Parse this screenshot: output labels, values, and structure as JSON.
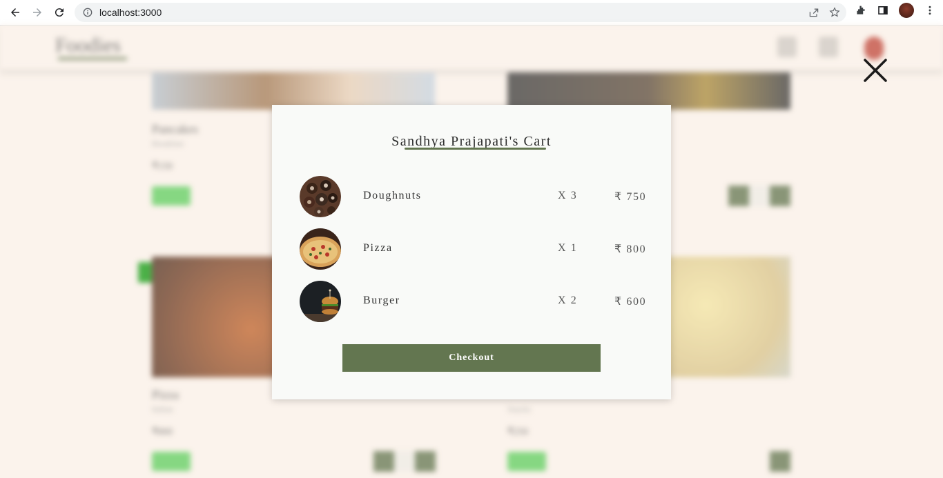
{
  "browser": {
    "url": "localhost:3000"
  },
  "app": {
    "logo": "Foodies",
    "cards": [
      {
        "title": "Pancakes",
        "subtitle": "Breakfast",
        "price": "₹150"
      },
      {
        "title": "Pizza",
        "subtitle": "Italian",
        "price": "₹800"
      },
      {
        "title": "",
        "subtitle": "Snacks",
        "price": "₹250"
      }
    ]
  },
  "cart": {
    "title": "Sandhya Prajapati's Cart",
    "items": [
      {
        "name": "Doughnuts",
        "qty": "X 3",
        "price": "₹ 750",
        "image": "doughnuts-image"
      },
      {
        "name": "Pizza",
        "qty": "X 1",
        "price": "₹ 800",
        "image": "pizza-image"
      },
      {
        "name": "Burger",
        "qty": "X 2",
        "price": "₹ 600",
        "image": "burger-image"
      }
    ],
    "checkout_label": "Checkout"
  },
  "colors": {
    "accent": "#637650",
    "page_bg": "#fbf3ec",
    "modal_bg": "#f9faf8"
  }
}
